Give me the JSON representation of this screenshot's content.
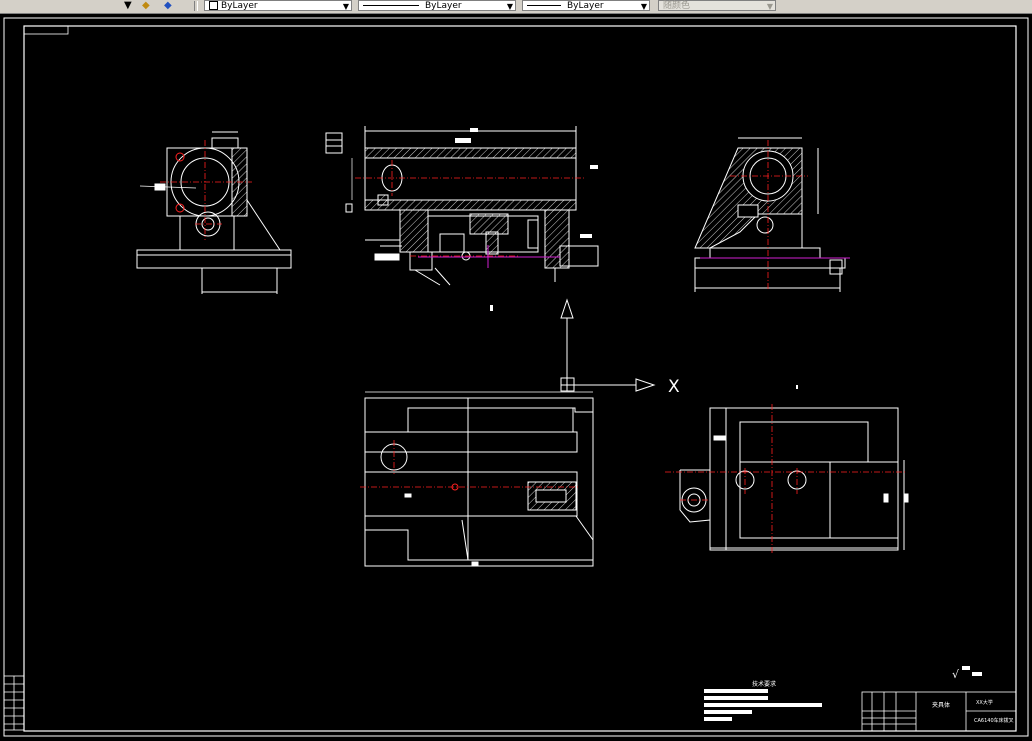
{
  "toolbar": {
    "color_combo": "ByLayer",
    "linetype_combo": "ByLayer",
    "lineweight_combo": "ByLayer",
    "plotstyle_combo": "随颜色"
  },
  "drawing": {
    "ucs_x_label": "X",
    "surface_finish": "√",
    "tech_title": "技术要求",
    "title_block": {
      "drawing_name": "夹具体",
      "school": "XX大学",
      "part_no": "CA6140车床拨叉"
    }
  },
  "colors": {
    "background": "#000000",
    "line": "#ffffff",
    "center": "#ff2020",
    "hatch": "#ffffff",
    "aux": "#d020d0"
  }
}
